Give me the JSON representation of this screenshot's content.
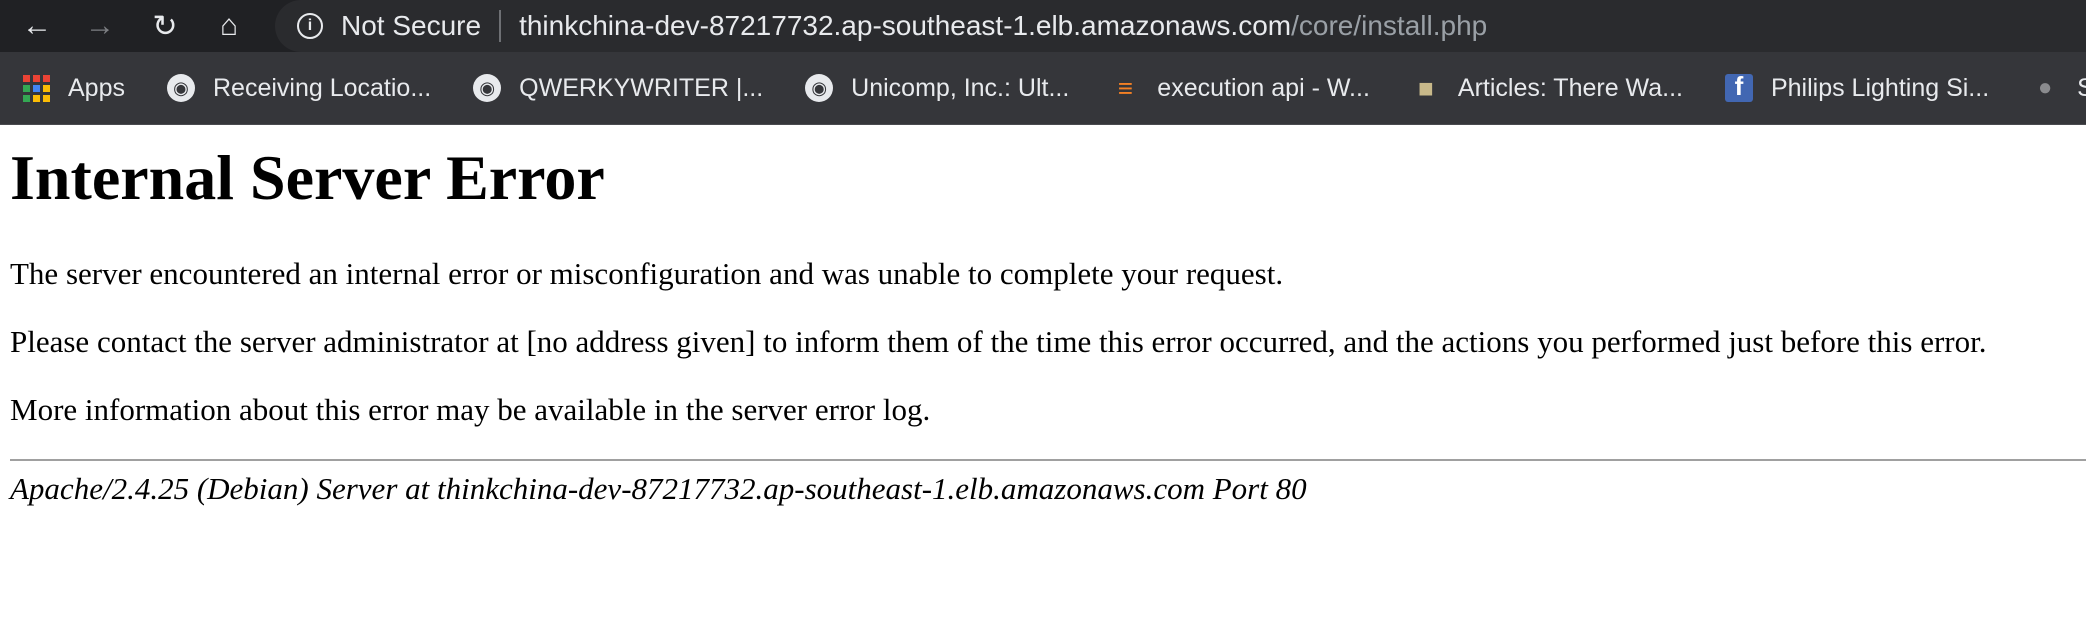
{
  "browser": {
    "nav": {
      "back_icon": "arrow-left-icon",
      "forward_icon": "arrow-right-icon",
      "reload_icon": "reload-icon",
      "home_icon": "home-icon"
    },
    "address_bar": {
      "security_label": "Not Secure",
      "host": "thinkchina-dev-87217732.ap-southeast-1.elb.amazonaws.com",
      "path": "/core/install.php"
    },
    "bookmarks": [
      {
        "label": "Apps",
        "icon": "apps-grid-icon"
      },
      {
        "label": "Receiving Locatio...",
        "icon": "globe-icon"
      },
      {
        "label": "QWERKYWRITER |...",
        "icon": "globe-icon"
      },
      {
        "label": "Unicomp, Inc.: Ult...",
        "icon": "globe-icon"
      },
      {
        "label": "execution api - W...",
        "icon": "stackoverflow-icon"
      },
      {
        "label": "Articles: There Wa...",
        "icon": "top-hat-icon"
      },
      {
        "label": "Philips Lighting Si...",
        "icon": "facebook-icon"
      },
      {
        "label": "Sta",
        "icon": "apple-icon"
      }
    ]
  },
  "page": {
    "title": "Internal Server Error",
    "paragraphs": [
      "The server encountered an internal error or misconfiguration and was unable to complete your request.",
      "Please contact the server administrator at [no address given] to inform them of the time this error occurred, and the actions you performed just before this error.",
      "More information about this error may be available in the server error log."
    ],
    "signature": "Apache/2.4.25 (Debian) Server at thinkchina-dev-87217732.ap-southeast-1.elb.amazonaws.com Port 80"
  }
}
